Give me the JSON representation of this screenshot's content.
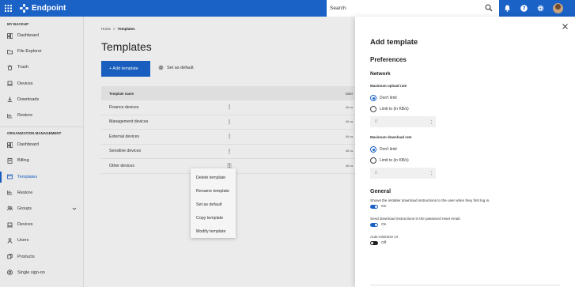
{
  "header": {
    "brand": "Endpoint",
    "search_label": "Search",
    "colors": {
      "topbar": "#1a62c6",
      "accent": "#1a62c6"
    }
  },
  "sidebar": {
    "section1_title": "MY BACKUP",
    "section1_items": [
      {
        "label": "Dashboard",
        "icon": "dashboard-icon"
      },
      {
        "label": "File Explorer",
        "icon": "folder-icon"
      },
      {
        "label": "Trash",
        "icon": "trash-icon"
      },
      {
        "label": "Devices",
        "icon": "laptop-icon"
      },
      {
        "label": "Downloads",
        "icon": "download-icon"
      },
      {
        "label": "Restore",
        "icon": "restore-icon"
      }
    ],
    "section2_title": "ORGANIZATION MANAGEMENT",
    "section2_items": [
      {
        "label": "Dashboard",
        "icon": "dashboard-icon"
      },
      {
        "label": "Billing",
        "icon": "billing-icon"
      },
      {
        "label": "Templates",
        "icon": "template-icon",
        "active": true
      },
      {
        "label": "Restore",
        "icon": "restore-icon"
      },
      {
        "label": "Groups",
        "icon": "groups-icon"
      },
      {
        "label": "Devices",
        "icon": "laptop-icon"
      },
      {
        "label": "Users",
        "icon": "users-icon"
      },
      {
        "label": "Products",
        "icon": "products-icon"
      },
      {
        "label": "Single sign-on",
        "icon": "sso-icon"
      }
    ]
  },
  "main": {
    "breadcrumb_home": "Home",
    "breadcrumb_sep": ">",
    "breadcrumb_current": "Templates",
    "title": "Templates",
    "add_button": "+ Add template",
    "default_button": "Set as default",
    "table": {
      "col_name": "Template name",
      "col_users": "User",
      "rows": [
        {
          "name": "Finance devices",
          "users": "All us"
        },
        {
          "name": "Management devices",
          "users": "All us"
        },
        {
          "name": "External devices",
          "users": "All us"
        },
        {
          "name": "Sensitive devices",
          "users": "All us"
        },
        {
          "name": "Other devices",
          "users": "All us"
        }
      ]
    },
    "context_menu": [
      "Delete template",
      "Rename template",
      "Set as default",
      "Copy template",
      "Modify template"
    ]
  },
  "panel": {
    "title": "Add template",
    "preferences": "Preferences",
    "network": "Network",
    "upload_label": "Maximum upload rate",
    "upload_opt1": "Don't limit",
    "upload_opt2": "Limit to (in KB/s)",
    "upload_value": "0",
    "download_label": "Maximum download rate",
    "download_opt1": "Don't limit",
    "download_opt2": "Limit to (in KB/s)",
    "download_value": "0",
    "general": "General",
    "gen1_desc": "Shows the installer download instructions to the user when they first log in.",
    "gen1_state": "On",
    "gen2_desc": "Send download instructions in the password reset email.",
    "gen2_state": "On",
    "gen3_desc": "Auto-minimize UI",
    "gen3_state": "Off"
  }
}
